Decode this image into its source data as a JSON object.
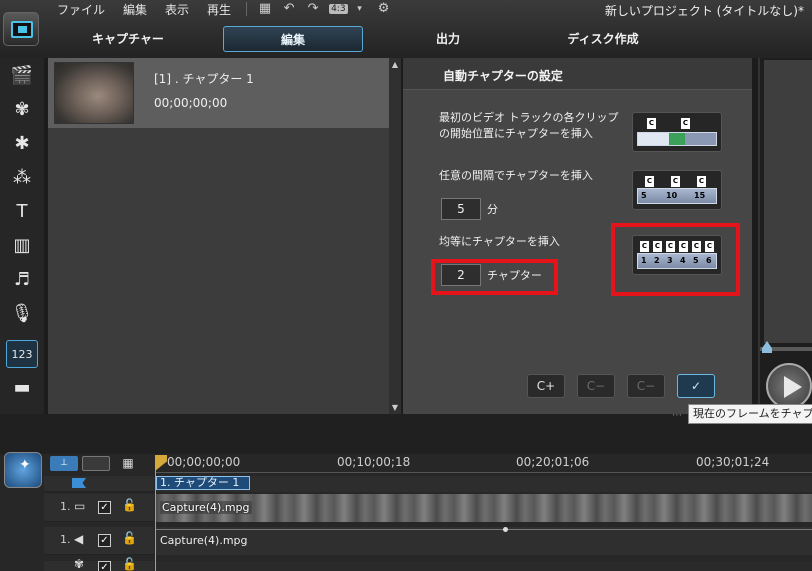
{
  "app": {
    "window_title": "新しいプロジェクト (タイトルなし)*",
    "menu": [
      "ファイル",
      "編集",
      "表示",
      "再生"
    ],
    "ratio_label": "4:3"
  },
  "tabs": [
    "キャプチャー",
    "編集",
    "出力",
    "ディスク作成"
  ],
  "active_tab": "編集",
  "sidebar_icons": [
    "media-library-icon",
    "transition-icon",
    "effect-icon",
    "particle-icon",
    "title-icon",
    "pip-icon",
    "audio-icon",
    "narration-icon",
    "chapter-icon",
    "subtitle-icon"
  ],
  "library": {
    "chapter_item": {
      "name": "[1] . チャプター 1",
      "time": "00;00;00;00"
    }
  },
  "auto_chapter": {
    "title": "自動チャプターの設定",
    "option_clips": "最初のビデオ トラックの各クリップの開始位置にチャプターを挿入",
    "option_interval": "任意の間隔でチャプターを挿入",
    "interval_value": "5",
    "interval_unit": "分",
    "option_equal": "均等にチャプターを挿入",
    "count_value": "2",
    "count_unit": "チャプター",
    "icon_clips_flags": [
      "C",
      "C"
    ],
    "icon_interval_flags": [
      "C",
      "C",
      "C"
    ],
    "icon_interval_ruler": [
      "5",
      "10",
      "15"
    ],
    "icon_equal_flags": [
      "C",
      "C",
      "C",
      "C",
      "C",
      "C"
    ],
    "icon_equal_ruler": [
      "1",
      "2",
      "3",
      "4",
      "5",
      "6"
    ],
    "highlight_color": "#e5141b"
  },
  "panel_buttons": {
    "add_chapter": "C+",
    "remove_chapter": "C−",
    "remove_all": "C−",
    "set_frame": "✓"
  },
  "tooltip": "現在のフレームをチャプター",
  "timeline": {
    "timecodes": [
      "00;00;00;00",
      "00;10;00;18",
      "00;20;01;06",
      "00;30;01;24"
    ],
    "chapter_marker": "1. チャプター 1",
    "video_track_num": "1.",
    "audio_track_num": "1.",
    "video_clip": "Capture(4).mpg",
    "audio_clip": "Capture(4).mpg"
  }
}
